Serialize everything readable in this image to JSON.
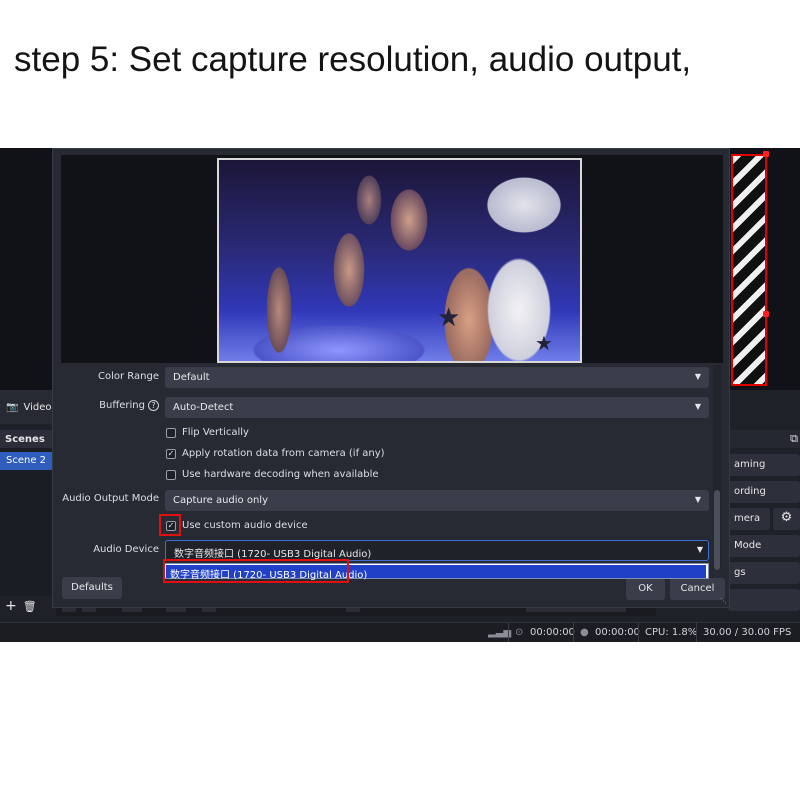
{
  "caption": "step 5: Set capture resolution, audio output,",
  "obs": {
    "sources": {
      "label": "Video"
    },
    "scenes": {
      "title": "Scenes",
      "items": [
        "Scene 2"
      ]
    },
    "controls": {
      "items": [
        "aming",
        "ording",
        "mera",
        "Mode",
        "gs"
      ]
    },
    "status": {
      "time1": "00:00:00",
      "time2": "00:00:00",
      "cpu": "CPU: 1.8%",
      "fps": "30.00 / 30.00 FPS"
    }
  },
  "dialog": {
    "color_range": {
      "label": "Color Range",
      "value": "Default"
    },
    "buffering": {
      "label": "Buffering",
      "value": "Auto-Detect"
    },
    "flip_vertically": {
      "label": "Flip Vertically",
      "checked": false
    },
    "apply_rotation": {
      "label": "Apply rotation data from camera (if any)",
      "checked": true
    },
    "hw_decoding": {
      "label": "Use hardware decoding when available",
      "checked": false
    },
    "audio_output_mode": {
      "label": "Audio Output Mode",
      "value": "Capture audio only"
    },
    "custom_audio": {
      "label": "Use custom audio device",
      "checked": true
    },
    "audio_device": {
      "label": "Audio Device",
      "value": "数字音频接口 (1720- USB3 Digital Audio)",
      "options": [
        "数字音频接口 (1720- USB3 Digital Audio)"
      ]
    },
    "buttons": {
      "defaults": "Defaults",
      "ok": "OK",
      "cancel": "Cancel"
    }
  },
  "icons": {
    "camera": "camera-icon",
    "help": "help-icon",
    "caret": "chevron-down-icon",
    "gear": "gear-icon",
    "add": "plus-icon",
    "trash": "trash-icon",
    "copy": "copy-icon"
  },
  "colors": {
    "accent": "#2f5dbd",
    "highlight": "#e01010",
    "selection": "#2140c8"
  }
}
